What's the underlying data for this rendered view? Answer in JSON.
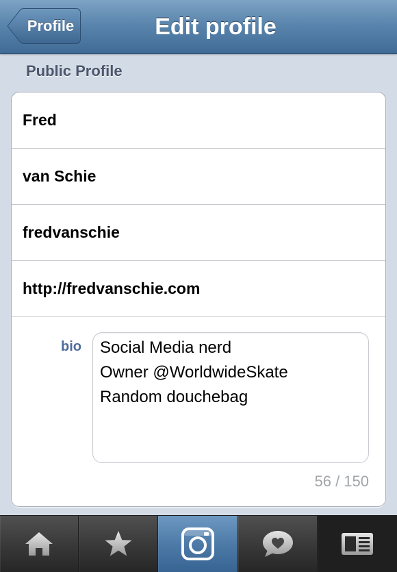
{
  "navbar": {
    "back_label": "Profile",
    "title": "Edit profile"
  },
  "section": {
    "header": "Public Profile"
  },
  "fields": {
    "first_name": "Fred",
    "last_name": "van Schie",
    "username": "fredvanschie",
    "website": "http://fredvanschie.com"
  },
  "bio": {
    "label": "bio",
    "lines": [
      "Social Media nerd",
      "Owner @WorldwideSkate",
      "Random douchebag"
    ],
    "counter": "56 / 150"
  },
  "tabbar": {
    "tabs": [
      {
        "icon": "home-icon",
        "selected": false
      },
      {
        "icon": "star-icon",
        "selected": false
      },
      {
        "icon": "camera-icon",
        "selected": true
      },
      {
        "icon": "news-bubble-icon",
        "selected": false
      },
      {
        "icon": "profile-card-icon",
        "selected": false
      }
    ]
  },
  "colors": {
    "navbar_blue": "#5a85ad",
    "background": "#d3dce6",
    "section_header": "#4c566c",
    "bio_label": "#4e6c9a",
    "counter_gray": "#a2a6aa",
    "tabbar_dark": "#3a3a3a"
  }
}
